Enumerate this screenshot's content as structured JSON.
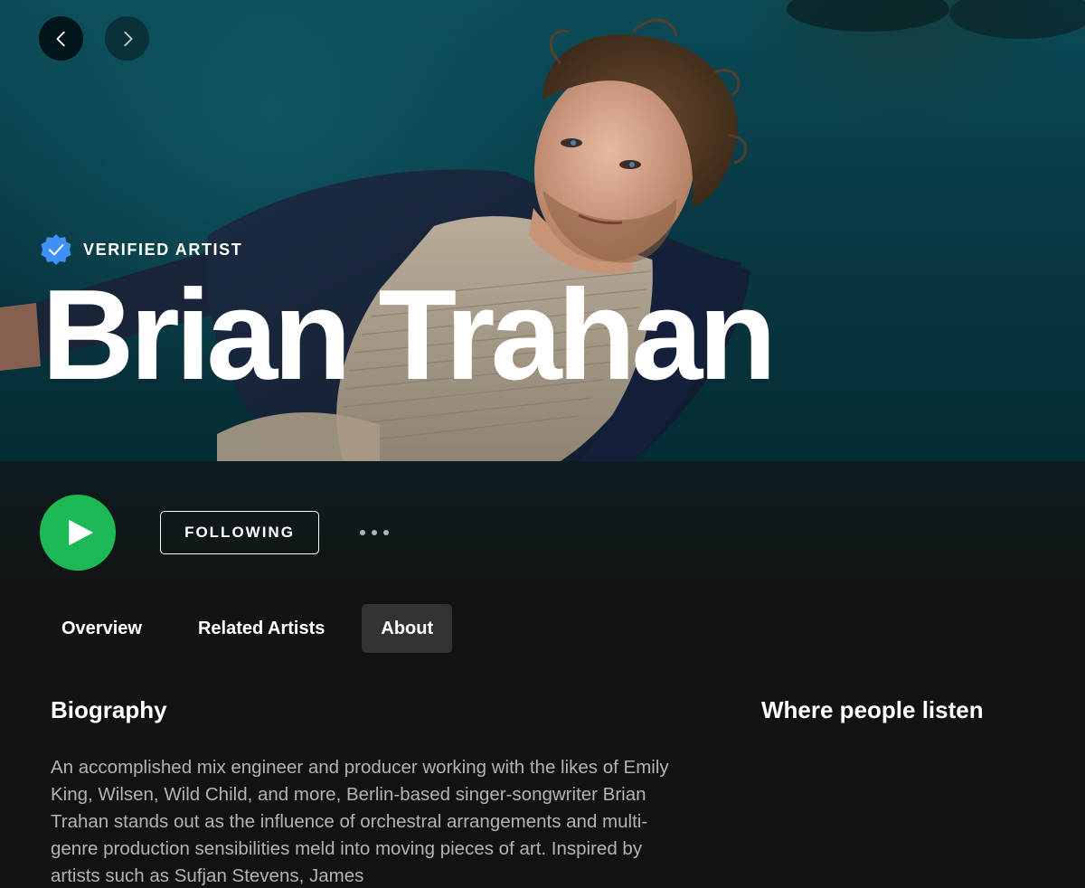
{
  "hero": {
    "verified_label": "VERIFIED ARTIST",
    "artist_name": "Brian Trahan"
  },
  "nav": {
    "back_icon": "chevron-left-icon",
    "forward_icon": "chevron-right-icon"
  },
  "actions": {
    "play_icon": "play-icon",
    "follow_label": "FOLLOWING",
    "more_icon": "more-options-icon"
  },
  "tabs": [
    {
      "label": "Overview",
      "active": false
    },
    {
      "label": "Related Artists",
      "active": false
    },
    {
      "label": "About",
      "active": true
    }
  ],
  "about": {
    "biography_heading": "Biography",
    "where_listen_heading": "Where people listen",
    "biography_text": "An accomplished mix engineer and producer working with the likes of Emily King, Wilsen, Wild Child, and more, Berlin-based singer-songwriter Brian Trahan stands out as the influence of orchestral arrangements and multi-genre production sensibilities meld into moving pieces of art. Inspired by artists such as Sufjan Stevens, James"
  },
  "colors": {
    "accent_green": "#1db954",
    "verified_blue": "#3d91f4",
    "background": "#121212",
    "text_secondary": "#b3b3b3",
    "tab_active_bg": "#333333"
  }
}
